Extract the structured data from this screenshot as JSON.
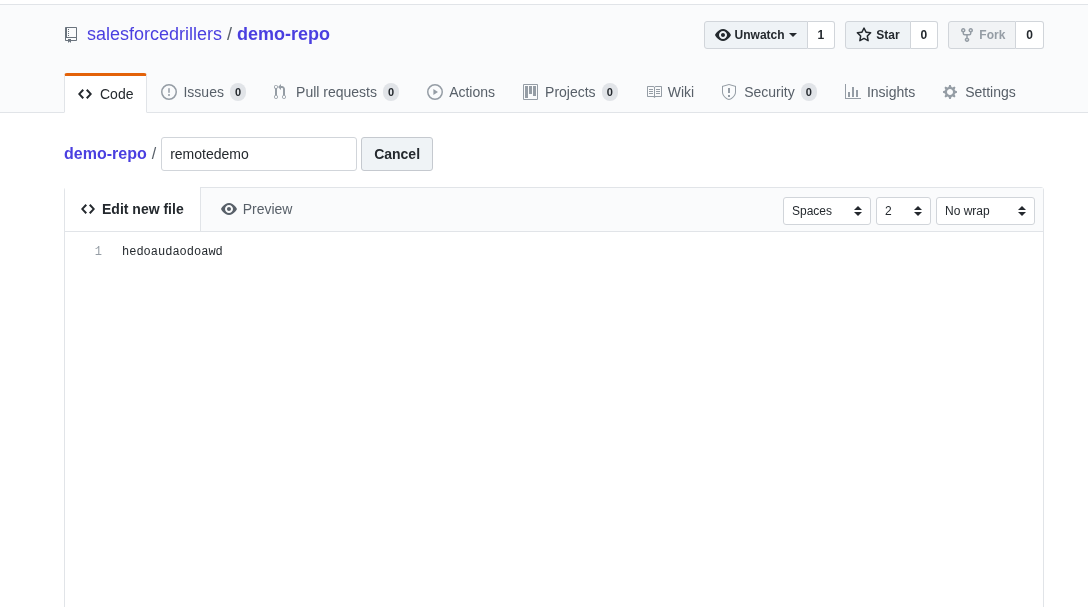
{
  "repo": {
    "owner": "salesforcedrillers",
    "separator": "/",
    "name": "demo-repo"
  },
  "actions": [
    {
      "kind": "watch",
      "label": "Unwatch",
      "count": "1",
      "disabled": false
    },
    {
      "kind": "star",
      "label": "Star",
      "count": "0",
      "disabled": false
    },
    {
      "kind": "fork",
      "label": "Fork",
      "count": "0",
      "disabled": true
    }
  ],
  "tabs": [
    {
      "kind": "code",
      "label": "Code",
      "selected": true
    },
    {
      "kind": "issue",
      "label": "Issues",
      "count": "0",
      "selected": false
    },
    {
      "kind": "pull",
      "label": "Pull requests",
      "count": "0",
      "selected": false
    },
    {
      "kind": "play",
      "label": "Actions",
      "selected": false
    },
    {
      "kind": "project",
      "label": "Projects",
      "count": "0",
      "selected": false
    },
    {
      "kind": "book",
      "label": "Wiki",
      "selected": false
    },
    {
      "kind": "shield",
      "label": "Security",
      "count": "0",
      "selected": false
    },
    {
      "kind": "graph",
      "label": "Insights",
      "selected": false
    },
    {
      "kind": "gear",
      "label": "Settings",
      "selected": false
    }
  ],
  "path": {
    "repo": "demo-repo",
    "separator": "/",
    "filename": "remotedemo",
    "cancel": "Cancel"
  },
  "editor": {
    "tabs": [
      {
        "kind": "code",
        "label": "Edit new file",
        "selected": true
      },
      {
        "kind": "eye",
        "label": "Preview",
        "selected": false
      }
    ],
    "selects": [
      "Spaces",
      "2",
      "No wrap"
    ],
    "lines": [
      {
        "number": "1",
        "text": "hedoaudaodoawd"
      }
    ]
  }
}
